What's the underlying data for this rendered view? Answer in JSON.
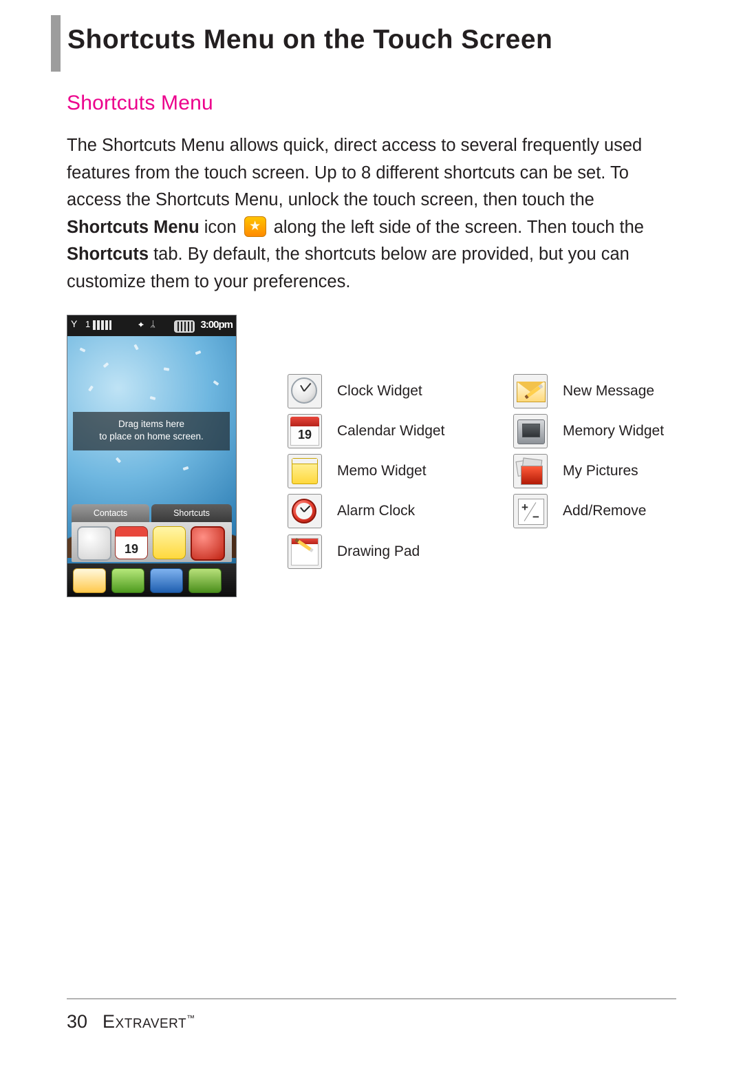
{
  "page": {
    "title": "Shortcuts Menu on the Touch Screen",
    "section_heading": "Shortcuts Menu",
    "body_part1": "The Shortcuts Menu allows quick, direct access to several frequently used features from the touch screen. Up to 8 different shortcuts can be set. To access the Shortcuts Menu, unlock the touch screen, then touch the ",
    "body_bold1": "Shortcuts Menu",
    "body_part2": " icon ",
    "body_part3": " along the left side of the screen. Then touch the ",
    "body_bold2": "Shortcuts",
    "body_part4": " tab. By default, the shortcuts below are provided, but you can customize them to your preferences.",
    "accent_color": "#ec008c"
  },
  "phone": {
    "status": {
      "signal": "Y",
      "network": "1X",
      "mid_icons": "✦ ᛦ",
      "time": "3:00pm"
    },
    "drag_hint_line1": "Drag items here",
    "drag_hint_line2": "to place on home screen.",
    "tabs": [
      {
        "label": "Contacts"
      },
      {
        "label": "Shortcuts"
      }
    ]
  },
  "legend": {
    "left_column": [
      {
        "icon": "clock-widget-icon",
        "label": "Clock Widget"
      },
      {
        "icon": "calendar-widget-icon",
        "label": "Calendar Widget",
        "day": "19"
      },
      {
        "icon": "memo-widget-icon",
        "label": "Memo Widget"
      },
      {
        "icon": "alarm-clock-icon",
        "label": "Alarm Clock"
      },
      {
        "icon": "drawing-pad-icon",
        "label": "Drawing Pad"
      }
    ],
    "right_column": [
      {
        "icon": "new-message-icon",
        "label": "New Message"
      },
      {
        "icon": "memory-widget-icon",
        "label": "Memory Widget"
      },
      {
        "icon": "my-pictures-icon",
        "label": "My Pictures"
      },
      {
        "icon": "add-remove-icon",
        "label": "Add/Remove"
      }
    ]
  },
  "footer": {
    "page_number": "30",
    "brand": "Extravert",
    "trademark": "™"
  }
}
